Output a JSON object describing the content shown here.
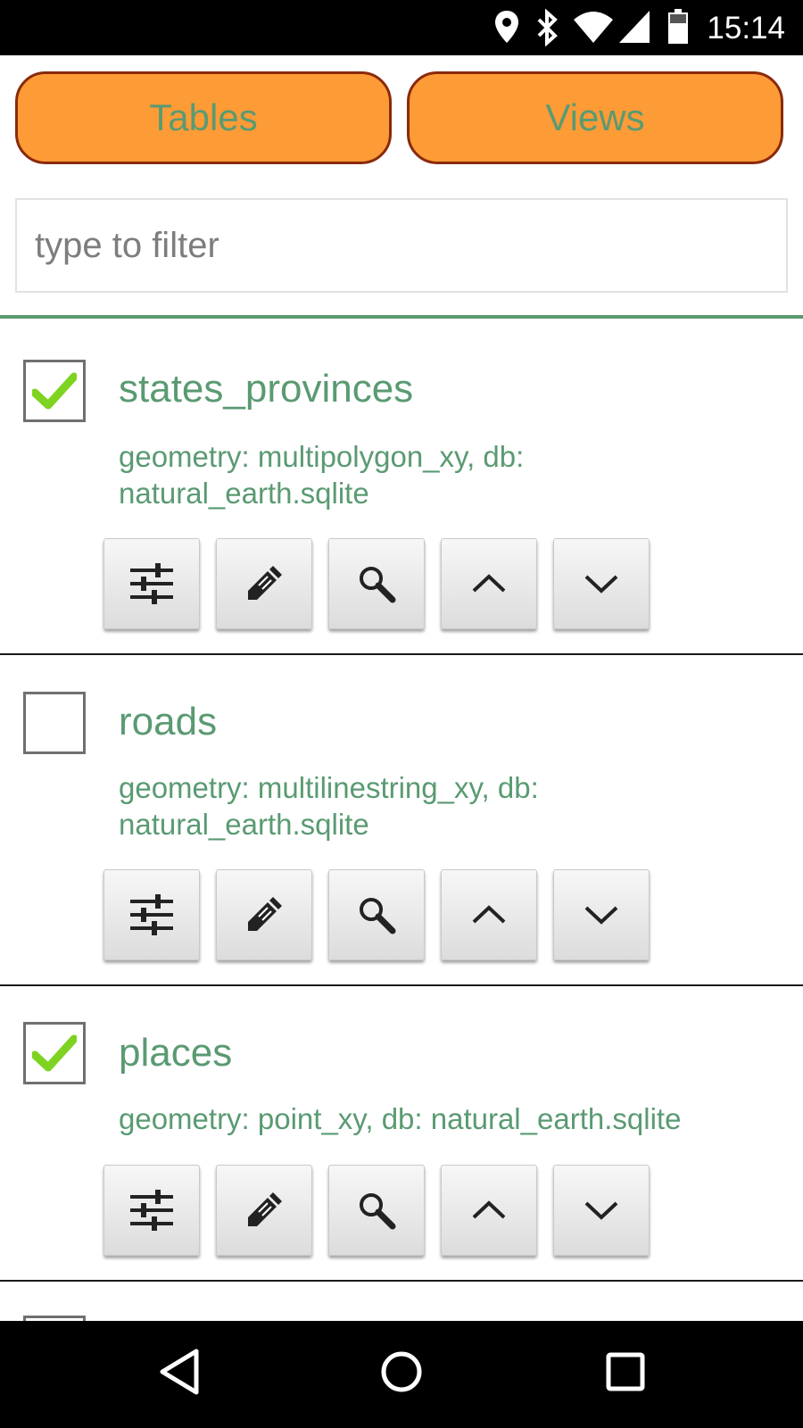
{
  "status_bar": {
    "time": "15:14",
    "icons": [
      "location-icon",
      "bluetooth-icon",
      "wifi-icon",
      "signal-icon",
      "battery-icon"
    ]
  },
  "tabs": [
    {
      "label": "Tables"
    },
    {
      "label": "Views"
    }
  ],
  "filter": {
    "placeholder": "type to filter",
    "value": ""
  },
  "colors": {
    "accent_green": "#5a9a72",
    "tab_orange": "#fd9b36",
    "tab_border": "#8a2a0c",
    "check_green": "#7ed321"
  },
  "layers": [
    {
      "name": "states_provinces",
      "description": "geometry: multipolygon_xy, db: natural_earth.sqlite",
      "checked": true
    },
    {
      "name": "roads",
      "description": "geometry: multilinestring_xy, db: natural_earth.sqlite",
      "checked": false
    },
    {
      "name": "places",
      "description": "geometry: point_xy, db: natural_earth.sqlite",
      "checked": true
    }
  ],
  "layer_buttons": [
    "settings-sliders-icon",
    "edit-pencil-icon",
    "zoom-search-icon",
    "move-up-icon",
    "move-down-icon"
  ],
  "nav_bar": [
    "back-icon",
    "home-icon",
    "recents-icon"
  ]
}
